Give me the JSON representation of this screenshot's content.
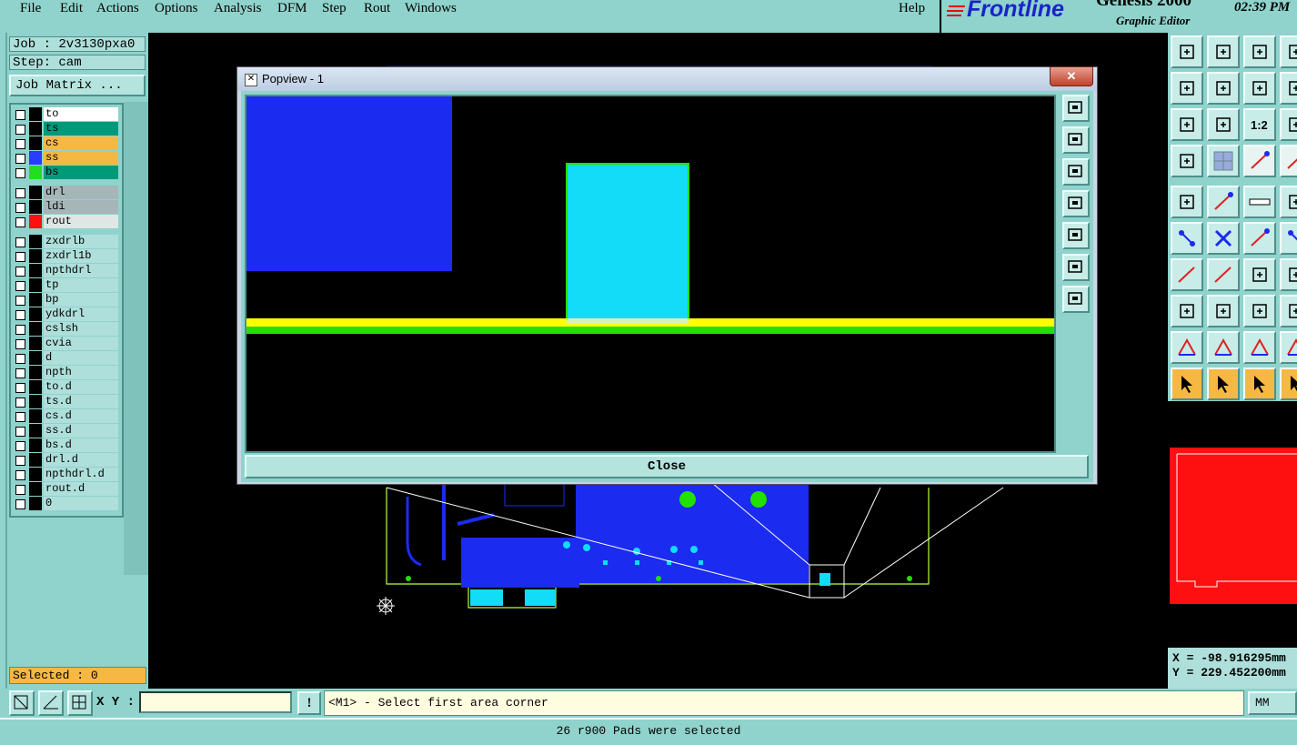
{
  "menu": {
    "file": "File",
    "edit": "Edit",
    "actions": "Actions",
    "options": "Options",
    "analysis": "Analysis",
    "dfm": "DFM",
    "step": "Step",
    "rout": "Rout",
    "windows": "Windows",
    "help": "Help"
  },
  "brand": {
    "logo": "Frontline",
    "product": "Genesis 2000",
    "subtitle": "Graphic Editor",
    "clock": "02:39 PM"
  },
  "job": {
    "job_line": "Job : 2v3130pxa0",
    "step_line": "Step: cam",
    "matrix_button": "Job Matrix ..."
  },
  "layers": [
    {
      "name": "to",
      "color": "#ffffff",
      "swatch": "#000000"
    },
    {
      "name": "ts",
      "color": "#009a7a",
      "swatch": "#000000"
    },
    {
      "name": "cs",
      "color": "#f5b842",
      "swatch": "#000000"
    },
    {
      "name": "ss",
      "color": "#f5b842",
      "swatch": "#2a3cff"
    },
    {
      "name": "bs",
      "color": "#009a7a",
      "swatch": "#22dd22"
    },
    {
      "name": "drl",
      "color": "#a5b5b8",
      "swatch": "#000000"
    },
    {
      "name": "ldi",
      "color": "#a5b5b8",
      "swatch": "#000000"
    },
    {
      "name": "rout",
      "color": "#e0e6e6",
      "swatch": "#ff1010"
    },
    {
      "name": "zxdrlb",
      "color": "#aedfda",
      "swatch": "#000000"
    },
    {
      "name": "zxdrl1b",
      "color": "#aedfda",
      "swatch": "#000000"
    },
    {
      "name": "npthdrl",
      "color": "#aedfda",
      "swatch": "#000000"
    },
    {
      "name": "tp",
      "color": "#aedfda",
      "swatch": "#000000"
    },
    {
      "name": "bp",
      "color": "#aedfda",
      "swatch": "#000000"
    },
    {
      "name": "ydkdrl",
      "color": "#aedfda",
      "swatch": "#000000"
    },
    {
      "name": "cslsh",
      "color": "#aedfda",
      "swatch": "#000000"
    },
    {
      "name": "cvia",
      "color": "#aedfda",
      "swatch": "#000000"
    },
    {
      "name": "d",
      "color": "#aedfda",
      "swatch": "#000000"
    },
    {
      "name": "npth",
      "color": "#aedfda",
      "swatch": "#000000"
    },
    {
      "name": "to.d",
      "color": "#aedfda",
      "swatch": "#000000"
    },
    {
      "name": "ts.d",
      "color": "#aedfda",
      "swatch": "#000000"
    },
    {
      "name": "cs.d",
      "color": "#aedfda",
      "swatch": "#000000"
    },
    {
      "name": "ss.d",
      "color": "#aedfda",
      "swatch": "#000000"
    },
    {
      "name": "bs.d",
      "color": "#aedfda",
      "swatch": "#000000"
    },
    {
      "name": "drl.d",
      "color": "#aedfda",
      "swatch": "#000000"
    },
    {
      "name": "npthdrl.d",
      "color": "#aedfda",
      "swatch": "#000000"
    },
    {
      "name": "rout.d",
      "color": "#aedfda",
      "swatch": "#000000"
    },
    {
      "name": "0",
      "color": "#aedfda",
      "swatch": "#000000"
    }
  ],
  "selected": "Selected : 0",
  "popup": {
    "title": "Popview - 1",
    "close_label": "Close",
    "close_x": "✕"
  },
  "coords": {
    "x": "X = -98.916295mm",
    "y": "Y = 229.452200mm"
  },
  "command": {
    "xy_label": "X Y :",
    "xy_value": "",
    "prompt": "<M1> - Select first area corner",
    "units": "MM"
  },
  "status": "26 r900 Pads were selected",
  "colors": {
    "panel": "#8fd3cc",
    "blue": "#1b2bf0",
    "cyan": "#12dcf7",
    "yellow": "#ffff00",
    "green": "#22e000",
    "rout_red": "#ff1010"
  }
}
